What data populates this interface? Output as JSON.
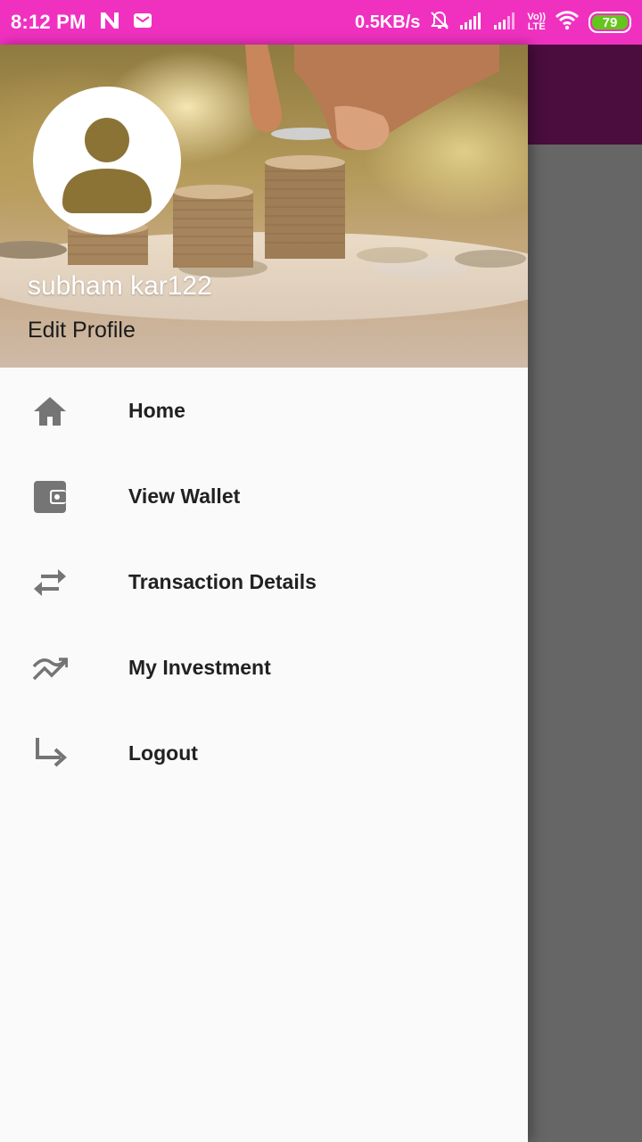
{
  "status_bar": {
    "time": "8:12 PM",
    "network_speed": "0.5KB/s",
    "volte_label_top": "Vo))",
    "volte_label_bottom": "LTE",
    "battery_level": "79",
    "icons": [
      "n-notification-icon",
      "mail-icon",
      "alarm-off-icon",
      "signal-icon",
      "signal-icon",
      "volte-icon",
      "wifi-icon",
      "battery-icon"
    ],
    "background_color": "#f031c0"
  },
  "drawer": {
    "header": {
      "user_name": "subham kar122",
      "edit_profile_label": "Edit Profile"
    },
    "menu_items": [
      {
        "label": "Home",
        "icon": "home-icon"
      },
      {
        "label": "View Wallet",
        "icon": "wallet-icon"
      },
      {
        "label": "Transaction Details",
        "icon": "swap-arrows-icon"
      },
      {
        "label": "My Investment",
        "icon": "trending-icon"
      },
      {
        "label": "Logout",
        "icon": "subdirectory-arrow-icon"
      }
    ]
  },
  "colors": {
    "status_bar": "#f031c0",
    "app_toolbar": "#4a0d3e",
    "scrim": "#666666",
    "menu_icon": "#757575",
    "menu_text": "#212121"
  }
}
